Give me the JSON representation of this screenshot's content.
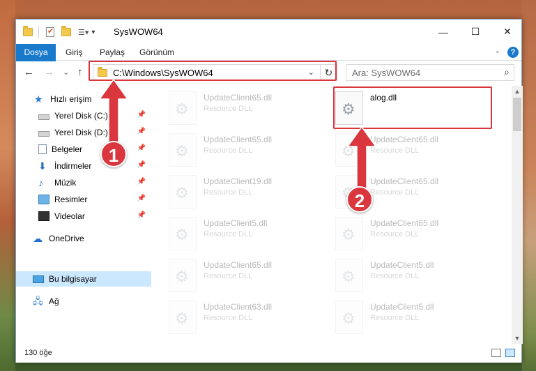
{
  "window": {
    "title": "SysWOW64"
  },
  "controls": {
    "minimize": "—",
    "maximize": "☐",
    "close": "✕"
  },
  "ribbon": {
    "tabs": [
      "Dosya",
      "Giriş",
      "Paylaş",
      "Görünüm"
    ],
    "expand_glyph": "⌄",
    "help_glyph": "?"
  },
  "nav": {
    "back": "←",
    "forward": "→",
    "recent": "⌄",
    "up": "↑"
  },
  "address": {
    "path": "C:\\Windows\\SysWOW64",
    "dropdown": "⌄",
    "refresh": "↻"
  },
  "search": {
    "placeholder": "Ara: SysWOW64",
    "icon": "⌕"
  },
  "sidebar": {
    "items": [
      {
        "label": "Hızlı erişim",
        "icon": "star-icon"
      },
      {
        "label": "Yerel Disk (C:)",
        "icon": "drive-icon",
        "pinned": true
      },
      {
        "label": "Yerel Disk (D:)",
        "icon": "drive-icon",
        "pinned": true
      },
      {
        "label": "Belgeler",
        "icon": "documents-icon",
        "pinned": true
      },
      {
        "label": "İndirmeler",
        "icon": "downloads-icon",
        "pinned": true
      },
      {
        "label": "Müzik",
        "icon": "music-icon",
        "pinned": true
      },
      {
        "label": "Resimler",
        "icon": "pictures-icon",
        "pinned": true
      },
      {
        "label": "Videolar",
        "icon": "videos-icon",
        "pinned": true
      },
      {
        "label": "OneDrive",
        "icon": "cloud-icon"
      },
      {
        "label": "Bu bilgisayar",
        "icon": "computer-icon",
        "selected": true
      },
      {
        "label": "Ağ",
        "icon": "network-icon"
      }
    ],
    "pin_glyph": "📌"
  },
  "files": [
    {
      "name": "UpdateClient65.dll",
      "type": "Resource DLL"
    },
    {
      "name": "alog.dll",
      "type": ""
    },
    {
      "name": "UpdateClient65.dll",
      "type": "Resource DLL"
    },
    {
      "name": "UpdateClient65.dll",
      "type": "Resource DLL"
    },
    {
      "name": "UpdateClient19.dll",
      "type": "Resource DLL"
    },
    {
      "name": "UpdateClient65.dll",
      "type": "Resource DLL"
    },
    {
      "name": "UpdateClient5.dll",
      "type": "Resource DLL"
    },
    {
      "name": "UpdateClient65.dll",
      "type": "Resource DLL"
    },
    {
      "name": "UpdateClient65.dll",
      "type": "Resource DLL"
    },
    {
      "name": "UpdateClient5.dll",
      "type": "Resource DLL"
    },
    {
      "name": "UpdateClient63.dll",
      "type": "Resource DLL"
    },
    {
      "name": "UpdateClient5.dll",
      "type": "Resource DLL"
    }
  ],
  "status": {
    "item_count": "130 öğe"
  },
  "annotations": {
    "step1": "1",
    "step2": "2",
    "color": "#d9363e"
  },
  "colors": {
    "accent": "#1979ca",
    "selection": "#cce8ff"
  }
}
